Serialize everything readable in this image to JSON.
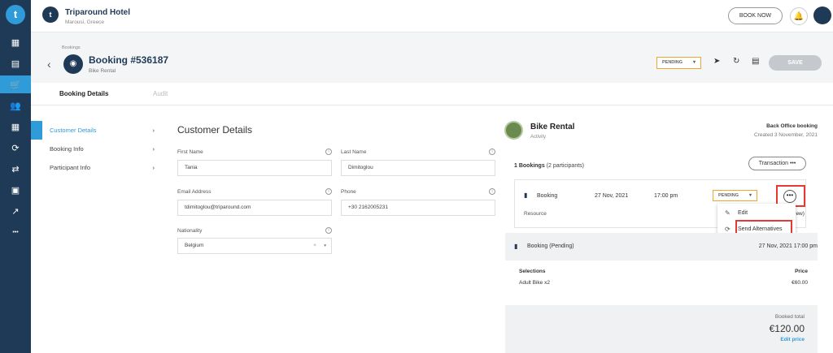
{
  "sidebar": {
    "logo": "t",
    "items": [
      {
        "icon": "dashboard-icon",
        "glyph": "▦"
      },
      {
        "icon": "calendar-icon",
        "glyph": "▤"
      },
      {
        "icon": "cart-icon",
        "glyph": "🛒"
      },
      {
        "icon": "users-icon",
        "glyph": "👥"
      },
      {
        "icon": "grid-icon",
        "glyph": "▦"
      },
      {
        "icon": "sync-icon",
        "glyph": "⟳"
      },
      {
        "icon": "transfer-icon",
        "glyph": "⇄"
      },
      {
        "icon": "briefcase-icon",
        "glyph": "▣"
      },
      {
        "icon": "chart-icon",
        "glyph": "↗"
      },
      {
        "icon": "more-icon",
        "glyph": "•••"
      }
    ]
  },
  "topbar": {
    "hotel_logo": "t",
    "hotel_name": "Triparound Hotel",
    "hotel_location": "Marousi, Greece",
    "book_now": "BOOK NOW",
    "bell_glyph": "🔔"
  },
  "header": {
    "breadcrumb": "Bookings",
    "back_glyph": "‹",
    "booking_glyph": "◉",
    "title": "Booking #536187",
    "subtitle": "Bike Rental",
    "status": "PENDING",
    "caret": "▾",
    "send_glyph": "➤",
    "refresh_glyph": "↻",
    "print_glyph": "▤",
    "save": "SAVE"
  },
  "tabs": {
    "active": "Booking Details",
    "inactive": "Audit"
  },
  "section_nav": [
    {
      "label": "Customer Details",
      "chev": "›"
    },
    {
      "label": "Booking Info",
      "chev": "›"
    },
    {
      "label": "Participant Info",
      "chev": "›"
    }
  ],
  "customer": {
    "title": "Customer Details",
    "info_glyph": "i",
    "first_name_label": "First Name",
    "first_name": "Tania",
    "last_name_label": "Last Name",
    "last_name": "Dimitoglou",
    "email_label": "Email Address",
    "email": "tdimitoglou@triparound.com",
    "phone_label": "Phone",
    "phone": "+30 2162005231",
    "nationality_label": "Nationality",
    "nationality": "Belgium",
    "clear_glyph": "×",
    "dropdown_glyph": "▾"
  },
  "activity": {
    "title": "Bike Rental",
    "subtitle": "Activity",
    "office_label": "Back Office booking",
    "created": "Created 3 November, 2021",
    "count_strong": "1 Bookings",
    "count_rest": "(2 participants)",
    "transaction": "Transaction  •••",
    "booking_glyph": "▮",
    "booking_label": "Booking",
    "booking_date": "27 Nov, 2021",
    "booking_time": "17:00 pm",
    "row_status": "PENDING",
    "more": "•••",
    "resource_label": "Resource",
    "view_fragment": "iew)",
    "menu_edit": "Edit",
    "menu_edit_glyph": "✎",
    "menu_send": "Send Alternatives",
    "menu_send_glyph": "⟳",
    "pending_label": "Booking (Pending)",
    "pending_date": "27 Nov, 2021 17:00 pm",
    "selections_label": "Selections",
    "price_label": "Price",
    "selection_item": "Adult Bike x2",
    "selection_price": "€60.00",
    "total_label": "Booked total",
    "total_value": "€120.00",
    "edit_price": "Edit price"
  }
}
